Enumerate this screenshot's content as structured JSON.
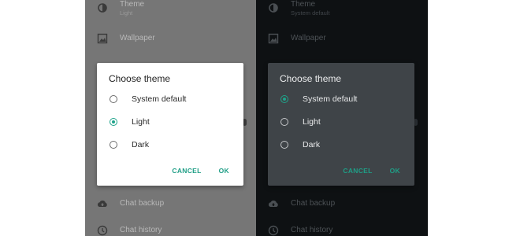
{
  "accent": "#1fa38a",
  "panels": [
    {
      "variant": "light",
      "settings_rows": [
        {
          "icon": "theme-icon",
          "title": "Theme",
          "subtitle": "Light"
        },
        {
          "icon": "wallpaper-icon",
          "title": "Wallpaper",
          "subtitle": ""
        },
        {
          "icon": "cloud-upload-icon",
          "title": "Chat backup",
          "subtitle": ""
        },
        {
          "icon": "history-icon",
          "title": "Chat history",
          "subtitle": ""
        }
      ],
      "dialog": {
        "title": "Choose theme",
        "options": [
          {
            "label": "System default",
            "selected": false
          },
          {
            "label": "Light",
            "selected": true
          },
          {
            "label": "Dark",
            "selected": false
          }
        ],
        "cancel_label": "CANCEL",
        "ok_label": "OK"
      }
    },
    {
      "variant": "dark",
      "settings_rows": [
        {
          "icon": "theme-icon",
          "title": "Theme",
          "subtitle": "System default"
        },
        {
          "icon": "wallpaper-icon",
          "title": "Wallpaper",
          "subtitle": ""
        },
        {
          "icon": "cloud-upload-icon",
          "title": "Chat backup",
          "subtitle": ""
        },
        {
          "icon": "history-icon",
          "title": "Chat history",
          "subtitle": ""
        }
      ],
      "dialog": {
        "title": "Choose theme",
        "options": [
          {
            "label": "System default",
            "selected": true
          },
          {
            "label": "Light",
            "selected": false
          },
          {
            "label": "Dark",
            "selected": false
          }
        ],
        "cancel_label": "CANCEL",
        "ok_label": "OK"
      }
    }
  ]
}
